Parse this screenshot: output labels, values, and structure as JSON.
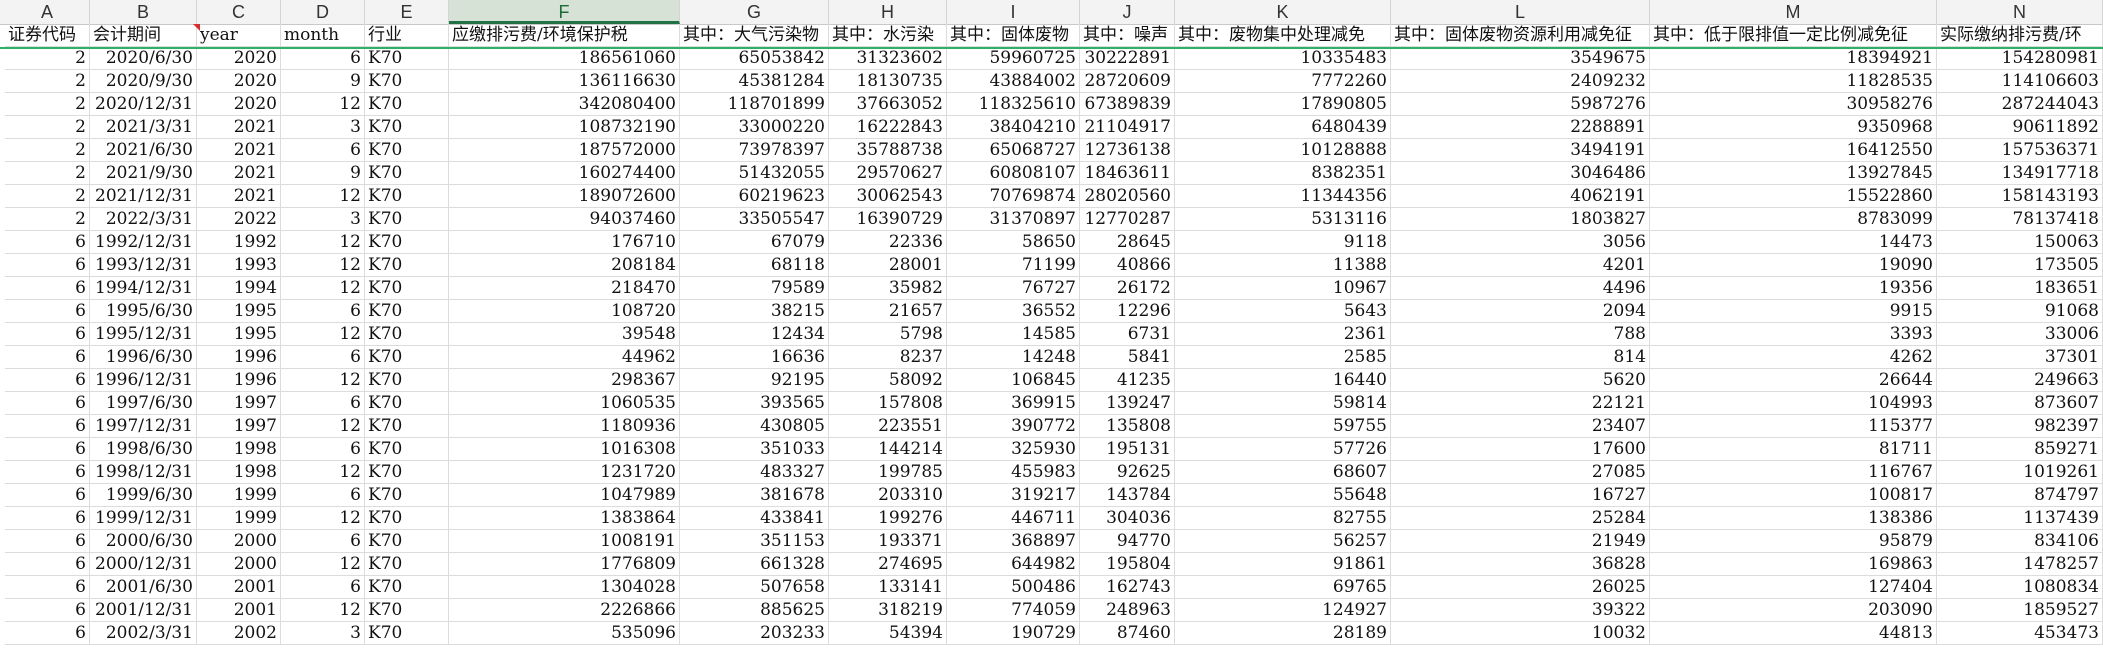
{
  "sheet": {
    "column_letters": [
      "A",
      "B",
      "C",
      "D",
      "E",
      "F",
      "G",
      "H",
      "I",
      "J",
      "K",
      "L",
      "M",
      "N"
    ],
    "selected_column": "F",
    "headers": [
      "证券代码",
      "会计期间",
      "year",
      "month",
      "行业",
      "应缴排污费/环境保护税",
      "其中：大气污染物",
      "其中：水污染",
      "其中：固体废物",
      "其中：噪声",
      "其中：废物集中处理减免",
      "其中：固体废物资源利用减免征",
      "其中：低于限排值一定比例减免征",
      "实际缴纳排污费/环"
    ],
    "rows": [
      [
        "2",
        "2020/6/30",
        "2020",
        "6",
        "K70",
        "186561060",
        "65053842",
        "31323602",
        "59960725",
        "30222891",
        "10335483",
        "3549675",
        "18394921",
        "154280981"
      ],
      [
        "2",
        "2020/9/30",
        "2020",
        "9",
        "K70",
        "136116630",
        "45381284",
        "18130735",
        "43884002",
        "28720609",
        "7772260",
        "2409232",
        "11828535",
        "114106603"
      ],
      [
        "2",
        "2020/12/31",
        "2020",
        "12",
        "K70",
        "342080400",
        "118701899",
        "37663052",
        "118325610",
        "67389839",
        "17890805",
        "5987276",
        "30958276",
        "287244043"
      ],
      [
        "2",
        "2021/3/31",
        "2021",
        "3",
        "K70",
        "108732190",
        "33000220",
        "16222843",
        "38404210",
        "21104917",
        "6480439",
        "2288891",
        "9350968",
        "90611892"
      ],
      [
        "2",
        "2021/6/30",
        "2021",
        "6",
        "K70",
        "187572000",
        "73978397",
        "35788738",
        "65068727",
        "12736138",
        "10128888",
        "3494191",
        "16412550",
        "157536371"
      ],
      [
        "2",
        "2021/9/30",
        "2021",
        "9",
        "K70",
        "160274400",
        "51432055",
        "29570627",
        "60808107",
        "18463611",
        "8382351",
        "3046486",
        "13927845",
        "134917718"
      ],
      [
        "2",
        "2021/12/31",
        "2021",
        "12",
        "K70",
        "189072600",
        "60219623",
        "30062543",
        "70769874",
        "28020560",
        "11344356",
        "4062191",
        "15522860",
        "158143193"
      ],
      [
        "2",
        "2022/3/31",
        "2022",
        "3",
        "K70",
        "94037460",
        "33505547",
        "16390729",
        "31370897",
        "12770287",
        "5313116",
        "1803827",
        "8783099",
        "78137418"
      ],
      [
        "6",
        "1992/12/31",
        "1992",
        "12",
        "K70",
        "176710",
        "67079",
        "22336",
        "58650",
        "28645",
        "9118",
        "3056",
        "14473",
        "150063"
      ],
      [
        "6",
        "1993/12/31",
        "1993",
        "12",
        "K70",
        "208184",
        "68118",
        "28001",
        "71199",
        "40866",
        "11388",
        "4201",
        "19090",
        "173505"
      ],
      [
        "6",
        "1994/12/31",
        "1994",
        "12",
        "K70",
        "218470",
        "79589",
        "35982",
        "76727",
        "26172",
        "10967",
        "4496",
        "19356",
        "183651"
      ],
      [
        "6",
        "1995/6/30",
        "1995",
        "6",
        "K70",
        "108720",
        "38215",
        "21657",
        "36552",
        "12296",
        "5643",
        "2094",
        "9915",
        "91068"
      ],
      [
        "6",
        "1995/12/31",
        "1995",
        "12",
        "K70",
        "39548",
        "12434",
        "5798",
        "14585",
        "6731",
        "2361",
        "788",
        "3393",
        "33006"
      ],
      [
        "6",
        "1996/6/30",
        "1996",
        "6",
        "K70",
        "44962",
        "16636",
        "8237",
        "14248",
        "5841",
        "2585",
        "814",
        "4262",
        "37301"
      ],
      [
        "6",
        "1996/12/31",
        "1996",
        "12",
        "K70",
        "298367",
        "92195",
        "58092",
        "106845",
        "41235",
        "16440",
        "5620",
        "26644",
        "249663"
      ],
      [
        "6",
        "1997/6/30",
        "1997",
        "6",
        "K70",
        "1060535",
        "393565",
        "157808",
        "369915",
        "139247",
        "59814",
        "22121",
        "104993",
        "873607"
      ],
      [
        "6",
        "1997/12/31",
        "1997",
        "12",
        "K70",
        "1180936",
        "430805",
        "223551",
        "390772",
        "135808",
        "59755",
        "23407",
        "115377",
        "982397"
      ],
      [
        "6",
        "1998/6/30",
        "1998",
        "6",
        "K70",
        "1016308",
        "351033",
        "144214",
        "325930",
        "195131",
        "57726",
        "17600",
        "81711",
        "859271"
      ],
      [
        "6",
        "1998/12/31",
        "1998",
        "12",
        "K70",
        "1231720",
        "483327",
        "199785",
        "455983",
        "92625",
        "68607",
        "27085",
        "116767",
        "1019261"
      ],
      [
        "6",
        "1999/6/30",
        "1999",
        "6",
        "K70",
        "1047989",
        "381678",
        "203310",
        "319217",
        "143784",
        "55648",
        "16727",
        "100817",
        "874797"
      ],
      [
        "6",
        "1999/12/31",
        "1999",
        "12",
        "K70",
        "1383864",
        "433841",
        "199276",
        "446711",
        "304036",
        "82755",
        "25284",
        "138386",
        "1137439"
      ],
      [
        "6",
        "2000/6/30",
        "2000",
        "6",
        "K70",
        "1008191",
        "351153",
        "193371",
        "368897",
        "94770",
        "56257",
        "21949",
        "95879",
        "834106"
      ],
      [
        "6",
        "2000/12/31",
        "2000",
        "12",
        "K70",
        "1776809",
        "661328",
        "274695",
        "644982",
        "195804",
        "91861",
        "36828",
        "169863",
        "1478257"
      ],
      [
        "6",
        "2001/6/30",
        "2001",
        "6",
        "K70",
        "1304028",
        "507658",
        "133141",
        "500486",
        "162743",
        "69765",
        "26025",
        "127404",
        "1080834"
      ],
      [
        "6",
        "2001/12/31",
        "2001",
        "12",
        "K70",
        "2226866",
        "885625",
        "318219",
        "774059",
        "248963",
        "124927",
        "39322",
        "203090",
        "1859527"
      ],
      [
        "6",
        "2002/3/31",
        "2002",
        "3",
        "K70",
        "535096",
        "203233",
        "54394",
        "190729",
        "87460",
        "28189",
        "10032",
        "44813",
        "453473"
      ]
    ]
  }
}
